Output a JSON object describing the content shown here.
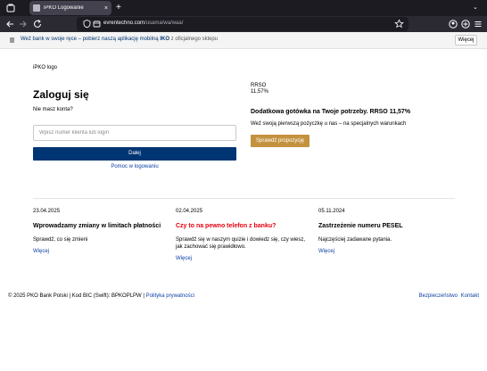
{
  "browser": {
    "tab_title": "iPKO Logowanie",
    "tab_close": "×",
    "new_tab": "+",
    "list_tabs": "⌄",
    "url_domain": "evrentechno.com",
    "url_path": "/usama/wa/waa/"
  },
  "banner": {
    "prefix": "Weź bank w swoje ręce – pobierz naszą aplikację mobilną ",
    "app_name": "IKO",
    "suffix": " z oficjalnego sklepu",
    "more_button": "Więcej"
  },
  "logo_text": "iPKO logo",
  "login": {
    "title": "Zaloguj się",
    "no_account": "Nie masz konta?",
    "client_placeholder": "Wpisz numer klienta lub login",
    "next_button": "Dalej",
    "help_link": "Pomoc w logowaniu"
  },
  "promo": {
    "rrso_label": "RRSO",
    "rrso_value": "11,57%",
    "title": "Dodatkowa gotówka na Twoje potrzeby. RRSO 11,57%",
    "description": "Weź swoją pierwszą pożyczkę u nas – na specjalnych warunkach",
    "button": "Sprawdź propozycję"
  },
  "news": [
    {
      "date": "23.04.2025",
      "title": "Wprowadzamy zmiany w limitach płatności",
      "text": "Sprawdź, co się zmieni",
      "more": "Więcej",
      "highlight": false
    },
    {
      "date": "02.04.2025",
      "title": "Czy to na pewno telefon z banku?",
      "text": "Sprawdź się w naszym quizie i dowiedz się, czy wiesz, jak zachować się prawidłowo.",
      "more": "Więcej",
      "highlight": true
    },
    {
      "date": "05.11.2024",
      "title": "Zastrzeżenie numeru PESEL",
      "text": "Najczęściej zadawane pytania.",
      "more": "Więcej",
      "highlight": false
    }
  ],
  "footer": {
    "copyright": "© 2025 PKO Bank Polski | Kod BIC (Swift): BPKOPLPW | ",
    "privacy": "Polityka prywatności",
    "security": "Bezpieczeństwo",
    "contact": "Kontakt"
  },
  "colors": {
    "brand_navy": "#003574",
    "promo_gold": "#c4923f",
    "alert_red": "#e3000f",
    "link_blue": "#0a3fa3"
  }
}
